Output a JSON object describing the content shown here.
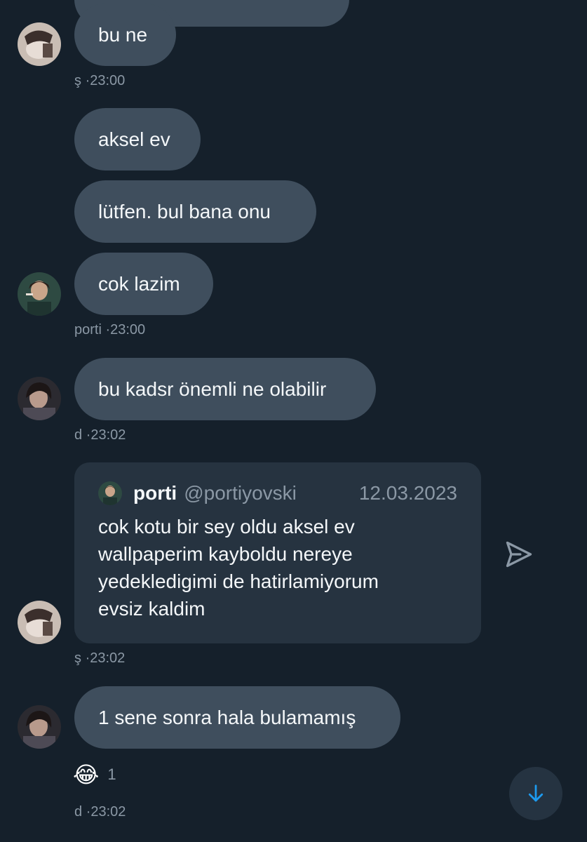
{
  "colors": {
    "background": "#15202b",
    "bubble": "#3f4e5d",
    "quote_card": "#263340",
    "meta_text": "#8b98a5",
    "accent": "#1d9bf0"
  },
  "messages": [
    {
      "text": "bu ne"
    },
    {
      "text": "aksel ev"
    },
    {
      "text": "lütfen. bul bana onu"
    },
    {
      "text": "cok lazim"
    },
    {
      "text": "bu kadsr önemli ne olabilir"
    },
    {
      "text": "1 sene sonra hala bulamamış"
    }
  ],
  "meta": [
    {
      "sender": "ş",
      "time": "·23:00"
    },
    {
      "sender": "porti",
      "time": "·23:00"
    },
    {
      "sender": "d",
      "time": "·23:02"
    },
    {
      "sender": "ş",
      "time": "·23:02"
    },
    {
      "sender": "d",
      "time": "·23:02"
    }
  ],
  "quoted_post": {
    "name": "porti",
    "handle": "@portiyovski",
    "date": "12.03.2023",
    "lines": [
      "cok kotu bir sey oldu aksel ev",
      "wallpaperim kayboldu nereye",
      "yedekledigimi de hatirlamiyorum",
      "evsiz kaldim"
    ]
  },
  "reaction": {
    "emoji": "😂",
    "count": "1"
  },
  "icons": {
    "send": "send-icon",
    "scroll_down": "arrow-down-icon"
  }
}
